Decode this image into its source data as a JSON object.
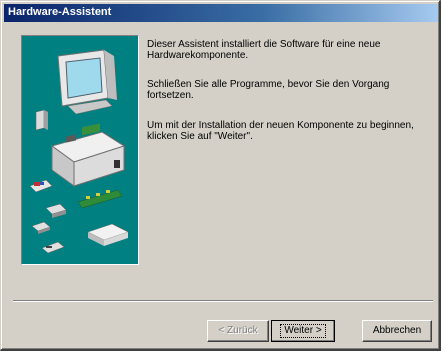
{
  "window": {
    "title": "Hardware-Assistent"
  },
  "content": {
    "paragraphs": [
      "Dieser Assistent installiert die Software für eine neue Hardwarekomponente.",
      "Schließen Sie alle Programme, bevor Sie den Vorgang fortsetzen.",
      "Um mit der Installation der neuen Komponente zu beginnen, klicken Sie auf \"Weiter\"."
    ]
  },
  "buttons": {
    "back": "< Zurück",
    "next": "Weiter >",
    "cancel": "Abbrechen"
  },
  "colors": {
    "titlebar_start": "#0a246a",
    "titlebar_end": "#a6caf0",
    "dialog_background": "#d4d0c8",
    "illustration_background": "#008080"
  }
}
